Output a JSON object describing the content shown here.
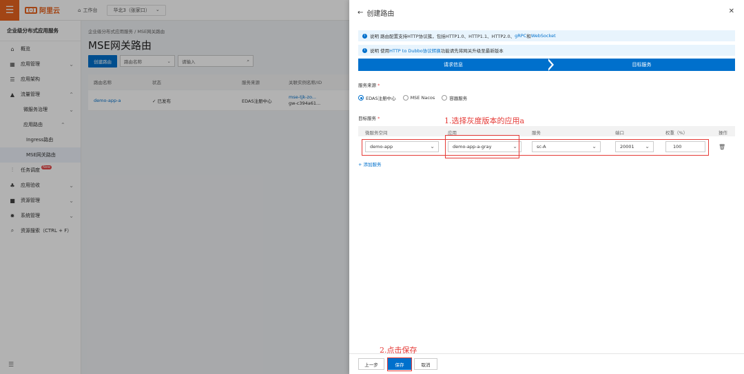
{
  "topbar": {
    "logo_text": "阿里云",
    "workbench": "工作台",
    "region": "华北3（张家口）"
  },
  "sidebar": {
    "title": "企业级分布式应用服务",
    "items": [
      {
        "label": "概览",
        "icon": "home-icon"
      },
      {
        "label": "应用管理",
        "icon": "grid-icon"
      },
      {
        "label": "应用架构",
        "icon": "layers-icon"
      },
      {
        "label": "流量管理",
        "icon": "warning-icon"
      },
      {
        "label": "微服务治理"
      },
      {
        "label": "应用路由"
      },
      {
        "label": "Ingress路由"
      },
      {
        "label": "MSE网关路由"
      },
      {
        "label": "任务调度",
        "icon": "schedule-icon",
        "badge": "New"
      },
      {
        "label": "应用验收",
        "icon": "tree-icon"
      },
      {
        "label": "资源管理",
        "icon": "folder-icon"
      },
      {
        "label": "系统管理",
        "icon": "gear-icon"
      },
      {
        "label": "资源搜索（CTRL + F）",
        "icon": "search-resource-icon"
      }
    ]
  },
  "main": {
    "breadcrumb": "企业级分布式应用服务  /  MSE网关路由",
    "title": "MSE网关路由",
    "create_button": "创建路由",
    "filter_select": "路由名称",
    "search_placeholder": "请输入",
    "columns": [
      "路由名称",
      "状态",
      "服务来源",
      "关联实例名称/ID"
    ],
    "rows": [
      {
        "name": "demo-app-a",
        "status": "已发布",
        "source": "EDAS注册中心",
        "instance": "mse-tjk-zo...",
        "instance_id": "gw-c394a61..."
      }
    ]
  },
  "drawer": {
    "title": "创建路由",
    "notice1": {
      "prefix": "说明 路由配置支持HTTP协议簇，包括HTTP1.0、HTTP1.1、HTTP2.0、",
      "link1": "gRPC",
      "mid": "和",
      "link2": "WebSocket"
    },
    "notice2": {
      "prefix": "说明 使用",
      "link": "HTTP to Dubbo协议转换",
      "suffix": "功能请先将网关升级至最新版本"
    },
    "steps": [
      "请求信息",
      "目标服务"
    ],
    "service_source_label": "服务来源",
    "service_sources": [
      "EDAS注册中心",
      "MSE Nacos",
      "容器服务"
    ],
    "selected_source": "EDAS注册中心",
    "target_service_label": "目标服务",
    "table_columns": [
      "微服务空间",
      "应用",
      "服务",
      "端口",
      "权重（%）",
      "操作"
    ],
    "row": {
      "namespace": "demo-app",
      "app": "demo-app-a-gray",
      "service": "sc-A",
      "port": "20001",
      "weight": "100"
    },
    "add_service": "+ 添加服务",
    "buttons": {
      "prev": "上一步",
      "save": "保存",
      "cancel": "取消"
    }
  },
  "annotations": {
    "step1": "1.选择灰度版本的应用a",
    "step2": "2.点击保存",
    "color": "#e53935"
  },
  "colors": {
    "primary": "#0070cc",
    "brand": "#e8641f",
    "annotation": "#e53935"
  }
}
